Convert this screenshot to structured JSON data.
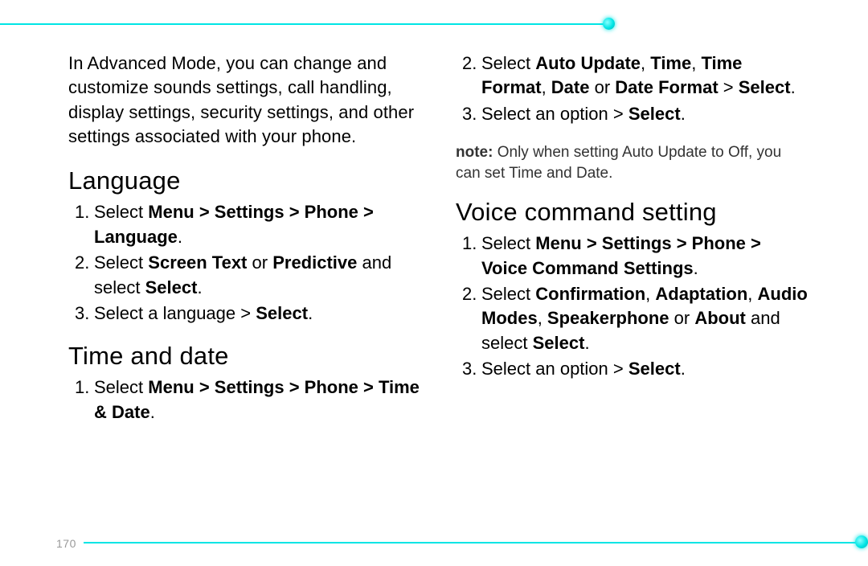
{
  "pageNumber": "170",
  "intro": "In Advanced Mode, you can change and customize sounds settings, call handling, display settings, security settings, and other settings associated with your phone.",
  "language": {
    "heading": "Language",
    "step1_path": "Menu > Settings > Phone > Language",
    "step2_opt1": "Screen Text",
    "step2_opt2": "Predictive",
    "step2_sel": "Select",
    "step3": "Select a language >",
    "step3_sel": "Select"
  },
  "timedate": {
    "heading": "Time and date",
    "step1_path": "Menu > Settings > Phone > Time & Date",
    "step2_p1": "Auto Update",
    "step2_p2": "Time",
    "step2_p3": "Time Format",
    "step2_p4": "Date",
    "step2_p5": "Date Format",
    "step2_sel": "Select",
    "step3": "Select an option >",
    "step3_sel": "Select"
  },
  "note": {
    "label": "note:",
    "text": "Only when setting Auto Update to Off, you can set Time and Date."
  },
  "voice": {
    "heading": "Voice command setting",
    "step1_path": "Menu > Settings > Phone > Voice Command Settings",
    "step2_p1": "Confirmation",
    "step2_p2": "Adaptation",
    "step2_p3": "Audio Modes",
    "step2_p4": "Speakerphone",
    "step2_p5": "About",
    "step2_sel": "Select",
    "step3": "Select an option >",
    "step3_sel": "Select"
  },
  "words": {
    "select": "Select",
    "or": "or",
    "andSelect": "and select"
  }
}
